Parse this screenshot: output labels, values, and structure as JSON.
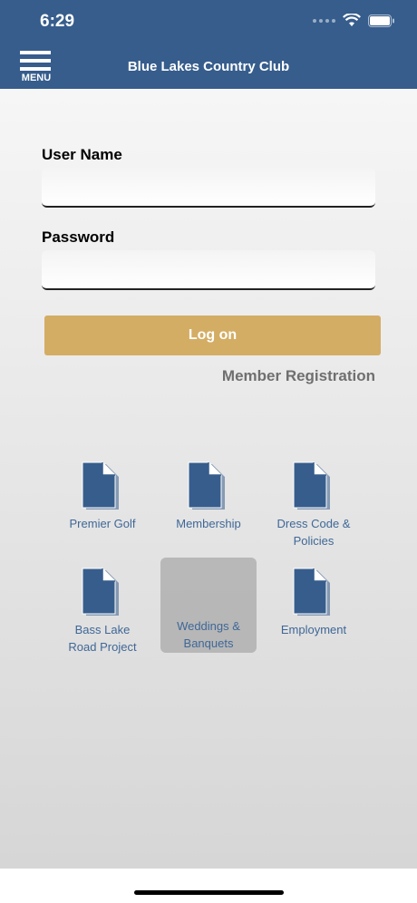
{
  "status_bar": {
    "time": "6:29"
  },
  "header": {
    "menu_label": "MENU",
    "title": "Blue Lakes Country Club"
  },
  "login": {
    "username_label": "User Name",
    "username_value": "",
    "password_label": "Password",
    "password_value": "",
    "logon_label": "Log on",
    "register_label": "Member Registration"
  },
  "tiles": [
    {
      "label_lines": [
        "Premier Golf",
        ""
      ],
      "icon": "document-icon"
    },
    {
      "label_lines": [
        "Membership",
        ""
      ],
      "icon": "document-icon"
    },
    {
      "label_lines": [
        "Dress Code &",
        "Policies"
      ],
      "icon": "document-icon"
    },
    {
      "label_lines": [
        "Bass Lake",
        "Road Project"
      ],
      "icon": "document-icon"
    },
    {
      "label_lines": [
        "Weddings &",
        "Banquets"
      ],
      "icon": "document-icon"
    },
    {
      "label_lines": [
        "Employment",
        ""
      ],
      "icon": "document-icon"
    }
  ],
  "colors": {
    "header": "#365d8c",
    "accent": "#d4ad64",
    "link_text": "#3f6797",
    "icon_fill": "#365d8c"
  }
}
